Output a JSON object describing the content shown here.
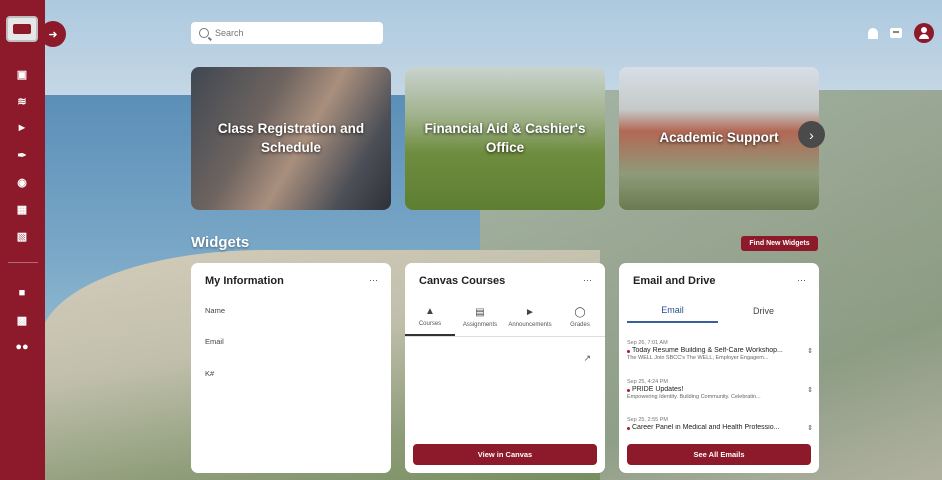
{
  "search": {
    "placeholder": "Search"
  },
  "carousel": [
    {
      "label": "Class Registration and Schedule"
    },
    {
      "label": "Financial Aid & Cashier's Office"
    },
    {
      "label": "Academic Support"
    }
  ],
  "widgets_header": {
    "title": "Widgets",
    "find_button": "Find New Widgets"
  },
  "my_information": {
    "title": "My Information",
    "more": "⋯",
    "fields": [
      "Name",
      "Email",
      "K#"
    ]
  },
  "canvas": {
    "title": "Canvas Courses",
    "more": "⋯",
    "tabs": [
      {
        "label": "Courses",
        "icon": "graduation-cap-icon"
      },
      {
        "label": "Assignments",
        "icon": "clipboard-icon"
      },
      {
        "label": "Announcements",
        "icon": "megaphone-icon"
      },
      {
        "label": "Grades",
        "icon": "award-icon"
      }
    ],
    "action": "View in Canvas"
  },
  "email_drive": {
    "title": "Email and Drive",
    "more": "⋯",
    "tabs": [
      "Email",
      "Drive"
    ],
    "emails": [
      {
        "date": "Sep 26, 7:01 AM",
        "subject": "Today Resume Building & Self-Care Workshop...",
        "preview": "The WELL Join SBCC's The WELL, Employer Engagem..."
      },
      {
        "date": "Sep 25, 4:24 PM",
        "subject": "PRIDE Updates!",
        "preview": "Empowering Identity. Building Community. Celebratin..."
      },
      {
        "date": "Sep 25, 2:55 PM",
        "subject": "Career Panel in Medical and Health Professio...",
        "preview": ""
      }
    ],
    "action": "See All Emails"
  },
  "colors": {
    "brand": "#8d1a2a",
    "tab_active": "#3b5f9a"
  }
}
